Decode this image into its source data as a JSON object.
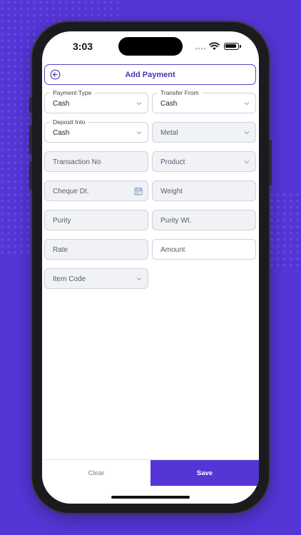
{
  "status_bar": {
    "time": "3:03"
  },
  "header": {
    "title": "Add Payment",
    "back_icon": "back-arrow-circle-icon"
  },
  "form": {
    "payment_type": {
      "label": "Payment Type",
      "value": "Cash"
    },
    "transfer_from": {
      "label": "Transfer From",
      "value": "Cash"
    },
    "deposit_into": {
      "label": "Deposit Into",
      "value": "Cash"
    },
    "metal": {
      "placeholder": "Metal"
    },
    "transaction_no": {
      "placeholder": "Transaction No"
    },
    "product": {
      "placeholder": "Product"
    },
    "cheque_dt": {
      "placeholder": "Cheque Dt."
    },
    "weight": {
      "placeholder": "Weight"
    },
    "purity": {
      "placeholder": "Purity"
    },
    "purity_wt": {
      "placeholder": "Purity Wt."
    },
    "rate": {
      "placeholder": "Rate"
    },
    "amount": {
      "placeholder": "Amount"
    },
    "item_code": {
      "placeholder": "Item Code"
    }
  },
  "footer": {
    "clear_label": "Clear",
    "save_label": "Save"
  },
  "colors": {
    "accent": "#5535d6",
    "title": "#4b33b8",
    "field_fill": "#f1f2f6",
    "border": "#cfd3db"
  }
}
